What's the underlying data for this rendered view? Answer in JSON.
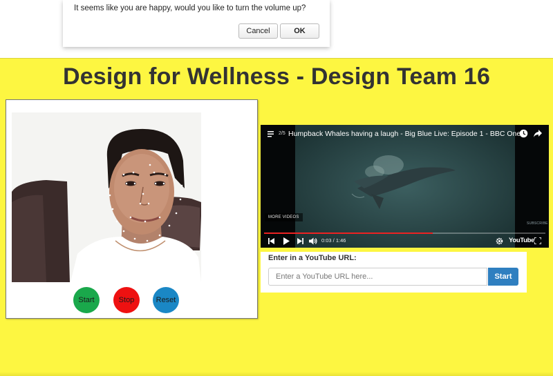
{
  "dialog": {
    "message": "It seems like you are happy, would you like to turn the volume up?",
    "cancel_label": "Cancel",
    "ok_label": "OK"
  },
  "page": {
    "title": "Design for Wellness - Design Team 16",
    "background_color": "#fdf641"
  },
  "webcam": {
    "buttons": {
      "start_label": "Start",
      "stop_label": "Stop",
      "reset_label": "Reset"
    },
    "button_colors": {
      "start": "#1aa84b",
      "stop": "#ee1111",
      "reset": "#1a87c5"
    }
  },
  "player": {
    "playlist_position": "2/5",
    "video_title": "Humpback Whales having a laugh - Big Blue Live: Episode 1 - BBC One",
    "more_videos_label": "MORE VIDEOS",
    "subscribe_label": "SUBSCRIBE",
    "current_time": "0:03",
    "duration": "1:46",
    "time_display": "0:03 / 1:46",
    "progress": 0.6,
    "logo": "YouTube",
    "icons": [
      "playlist-icon",
      "clock-icon",
      "share-icon",
      "skip-back-icon",
      "play-icon",
      "skip-forward-icon",
      "volume-icon",
      "gear-icon",
      "fullscreen-icon"
    ]
  },
  "url_form": {
    "label": "Enter in a YouTube URL:",
    "placeholder": "Enter a YouTube URL here...",
    "value": "",
    "start_label": "Start",
    "accent_color": "#2f7fc0"
  }
}
